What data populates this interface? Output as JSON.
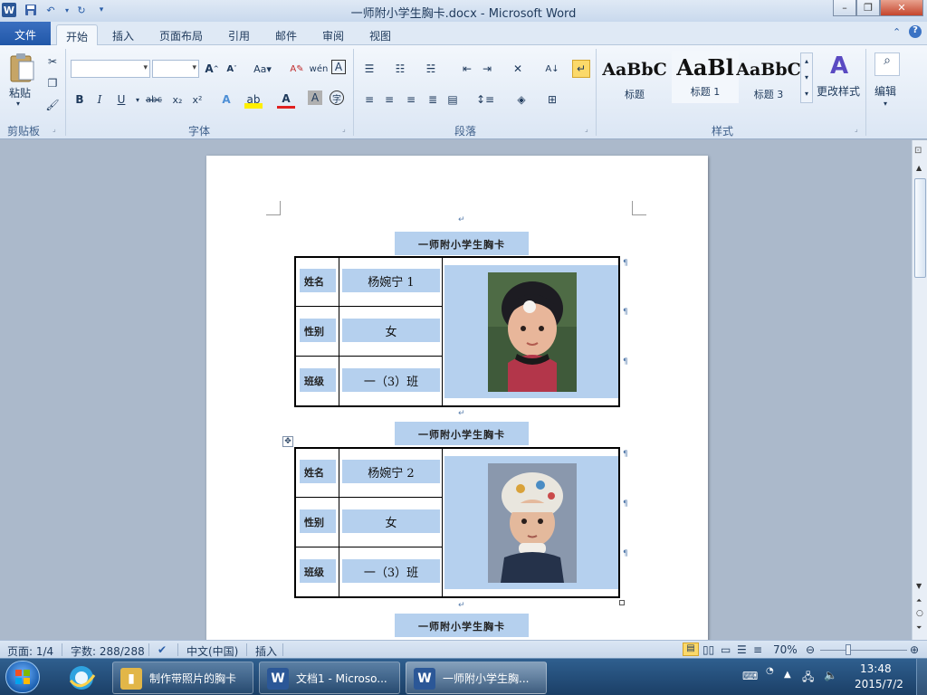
{
  "window": {
    "title": "一师附小学生胸卡.docx - Microsoft Word",
    "minimize": "–",
    "restore": "❐",
    "close": "✕"
  },
  "qat": {
    "word_icon": "W",
    "save_icon": "floppy-disk",
    "undo_icon": "undo",
    "redo_icon": "redo"
  },
  "tabs": [
    {
      "label": "文件"
    },
    {
      "label": "开始"
    },
    {
      "label": "插入"
    },
    {
      "label": "页面布局"
    },
    {
      "label": "引用"
    },
    {
      "label": "邮件"
    },
    {
      "label": "审阅"
    },
    {
      "label": "视图"
    }
  ],
  "ribbon": {
    "clipboard": {
      "paste_label": "粘贴",
      "group_label": "剪贴板"
    },
    "font": {
      "group_label": "字体",
      "font_name": "",
      "font_size": ""
    },
    "paragraph": {
      "group_label": "段落"
    },
    "styles": {
      "group_label": "样式",
      "items": [
        {
          "sample": "AaBbC",
          "name": "标题"
        },
        {
          "sample": "AaBl",
          "name": "标题 1"
        },
        {
          "sample": "AaBbC",
          "name": "标题 3"
        }
      ],
      "change_styles_label": "更改样式"
    },
    "editing": {
      "label": "编辑"
    }
  },
  "document": {
    "cards": [
      {
        "title": "一师附小学生胸卡",
        "name_label": "姓名",
        "name_value": "杨婉宁 1",
        "gender_label": "性别",
        "gender_value": "女",
        "class_label": "班级",
        "class_value": "一（3）班"
      },
      {
        "title": "一师附小学生胸卡",
        "name_label": "姓名",
        "name_value": "杨婉宁 2",
        "gender_label": "性别",
        "gender_value": "女",
        "class_label": "班级",
        "class_value": "一（3）班"
      },
      {
        "title": "一师附小学生胸卡"
      }
    ],
    "para_mark": "↵"
  },
  "status": {
    "page": "页面: 1/4",
    "words": "字数: 288/288",
    "language": "中文(中国)",
    "mode": "插入",
    "zoom": "70%"
  },
  "taskbar": {
    "items": [
      {
        "label": "制作带照片的胸卡"
      },
      {
        "label": "文档1 - Microso..."
      },
      {
        "label": "一师附小学生胸..."
      }
    ],
    "time": "13:48",
    "date": "2015/7/2"
  },
  "colors": {
    "highlight": "#b5d0ee",
    "ribbon": "#f3f7fc",
    "taskbar": "#1b3f66"
  }
}
